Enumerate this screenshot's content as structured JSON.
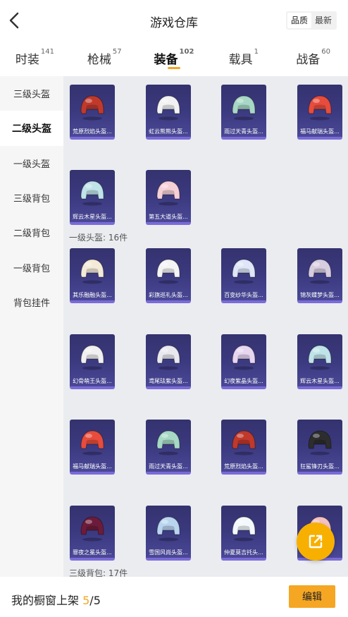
{
  "header": {
    "title": "游戏仓库",
    "sort_options": [
      "品质",
      "最新"
    ],
    "sort_active": 0
  },
  "tabs": [
    {
      "label": "时装",
      "count": "141"
    },
    {
      "label": "枪械",
      "count": "57"
    },
    {
      "label": "装备",
      "count": "102",
      "active": true
    },
    {
      "label": "载具",
      "count": "1"
    },
    {
      "label": "战备",
      "count": "60"
    }
  ],
  "sidebar": {
    "items": [
      "三级头盔",
      "二级头盔",
      "一级头盔",
      "三级背包",
      "二级背包",
      "一级背包",
      "背包挂件"
    ],
    "active_index": 1
  },
  "sections": {
    "top_items": [
      {
        "label": "荒原烈焰头盔...",
        "color": "#c0392b"
      },
      {
        "label": "虹云熊熊头盔...",
        "color": "#f2f2f2"
      },
      {
        "label": "雨过天青头盔...",
        "color": "#a7d7c5"
      },
      {
        "label": "福马献瑞头盔...",
        "color": "#e74c3c"
      },
      {
        "label": "辉云木星头盔...",
        "color": "#bfe3e8"
      },
      {
        "label": "第五大道头盔...",
        "color": "#f5d0d6"
      }
    ],
    "level1_label": "一级头盔: 16件",
    "level1_items": [
      {
        "label": "其乐融融头盔...",
        "color": "#f3ead8"
      },
      {
        "label": "彩旗巡礼头盔...",
        "color": "#f4f4f4"
      },
      {
        "label": "百变纱华头盔...",
        "color": "#dfe6f7"
      },
      {
        "label": "锦灰蝶梦头盔...",
        "color": "#d8cde0"
      },
      {
        "label": "幻骨萌王头盔...",
        "color": "#f0f0f0"
      },
      {
        "label": "鸢尾珐紫头盔...",
        "color": "#e8e8ee"
      },
      {
        "label": "幻夜紫晶头盔...",
        "color": "#e6d6f0"
      },
      {
        "label": "辉云木星头盔...",
        "color": "#bfe3e8"
      },
      {
        "label": "福马献瑞头盔...",
        "color": "#e74c3c"
      },
      {
        "label": "雨过天青头盔...",
        "color": "#a7d7c5"
      },
      {
        "label": "荒原烈焰头盔...",
        "color": "#c0392b"
      },
      {
        "label": "狂鲨锋刃头盔...",
        "color": "#2d2d2d"
      },
      {
        "label": "罪夜之冕头盔...",
        "color": "#6d1b3a"
      },
      {
        "label": "雪国风尚头盔...",
        "color": "#b9d4ef"
      },
      {
        "label": "仲夏莫吉托头...",
        "color": "#f2f8fb"
      },
      {
        "label": "",
        "color": "#f3c1c1"
      }
    ],
    "level3_pack_label": "三级背包: 17件"
  },
  "bottom": {
    "prefix": "我的橱窗上架",
    "current": "5",
    "total": "/5",
    "edit_label": "编辑"
  },
  "icons": {
    "back": "chevron-left-icon",
    "share": "share-external-icon"
  }
}
